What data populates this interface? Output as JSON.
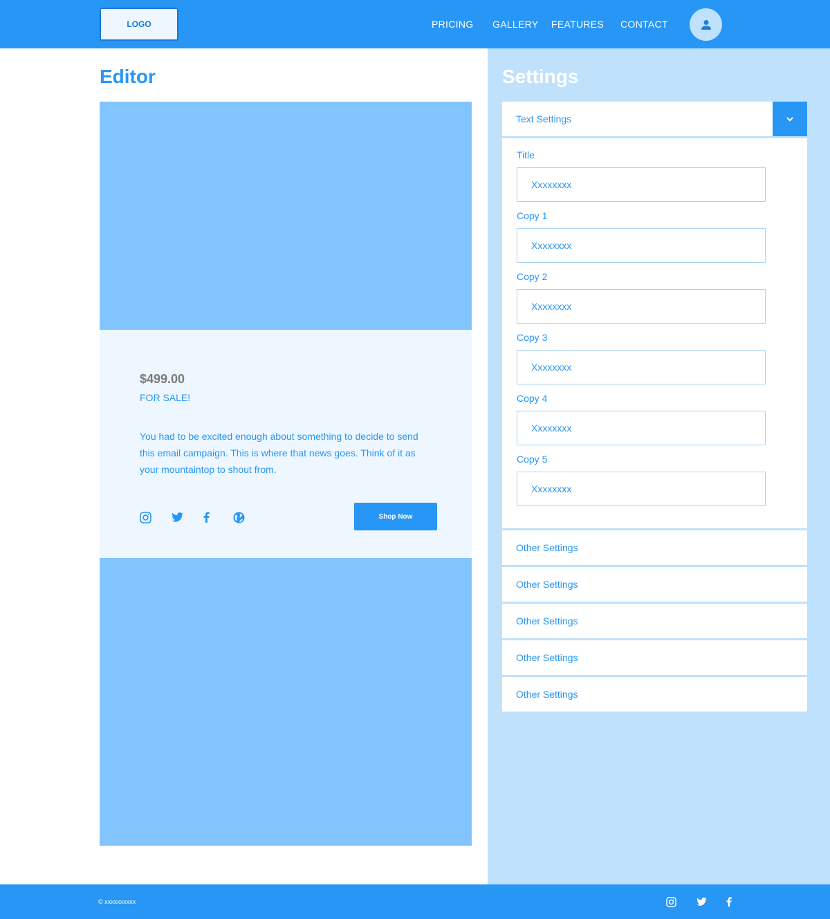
{
  "header": {
    "logo": "LOGO",
    "nav": [
      "PRICING",
      "GALLERY",
      "FEATURES",
      "CONTACT"
    ]
  },
  "editor": {
    "title": "Editor",
    "price": "$499.00",
    "sale": "FOR SALE!",
    "description": "You had to be excited enough about something to decide to send this email campaign. This is where that news goes. Think of it as your mountaintop to shout from.",
    "shop_button": "Shop Now",
    "social_icons": [
      "instagram-icon",
      "twitter-icon",
      "facebook-icon",
      "globe-icon"
    ]
  },
  "settings": {
    "title": "Settings",
    "text_settings": {
      "label": "Text Settings",
      "fields": [
        {
          "label": "Title",
          "value": "Xxxxxxxx"
        },
        {
          "label": "Copy 1",
          "value": "Xxxxxxxx"
        },
        {
          "label": "Copy 2",
          "value": "Xxxxxxxx"
        },
        {
          "label": "Copy 3",
          "value": "Xxxxxxxx"
        },
        {
          "label": "Copy 4",
          "value": "Xxxxxxxx"
        },
        {
          "label": "Copy 5",
          "value": "Xxxxxxxx"
        }
      ]
    },
    "other_settings": [
      "Other Settings",
      "Other Settings",
      "Other Settings",
      "Other Settings",
      "Other Settings"
    ]
  },
  "footer": {
    "copyright": "© xxxxxxxxxx",
    "social_icons": [
      "instagram-icon",
      "twitter-icon",
      "facebook-icon"
    ]
  },
  "colors": {
    "primary": "#2796f5",
    "light": "#bfe1fc",
    "image_placeholder": "#82c4fe",
    "card_bg": "#eef7ff"
  }
}
